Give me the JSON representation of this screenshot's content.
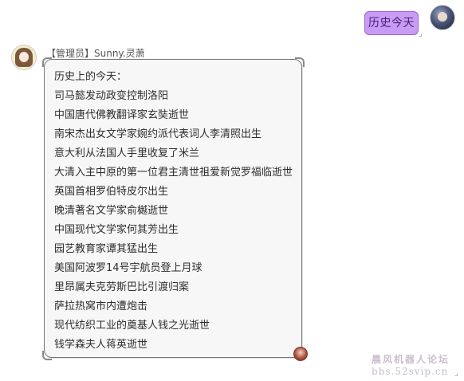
{
  "chat": {
    "outgoing": {
      "message": "历史今天"
    },
    "incoming": {
      "sender": "【管理员】Sunny.灵萧",
      "lines": [
        "历史上的今天：",
        "司马懿发动政变控制洛阳",
        "中国唐代佛教翻译家玄奘逝世",
        "南宋杰出女文学家婉约派代表词人李清照出生",
        "意大利从法国人手里收复了米兰",
        "大清入主中原的第一位君主清世祖爱新觉罗福临逝世",
        "英国首相罗伯特皮尔出生",
        "晚清著名文学家俞樾逝世",
        "中国现代文学家何其芳出生",
        "园艺教育家谭其猛出生",
        "美国阿波罗14号宇航员登上月球",
        "里昂属夫克劳斯巴比引渡归案",
        "萨拉热窝市内遭炮击",
        "现代纺织工业的奠基人钱之光逝世",
        "钱学森夫人蒋英逝世"
      ]
    }
  },
  "watermark": {
    "line1": "晨风机器人论坛",
    "line2": "bbs.52svip.cn"
  },
  "colors": {
    "outgoing_bubble": "#c99cf3",
    "outgoing_border": "#9d63d9",
    "incoming_bubble": "#f7f7f7",
    "incoming_border": "#777777"
  },
  "icons": {
    "outgoing_avatar": "user-avatar",
    "incoming_avatar": "admin-avatar",
    "sticker": "mini-sticker-icon"
  }
}
